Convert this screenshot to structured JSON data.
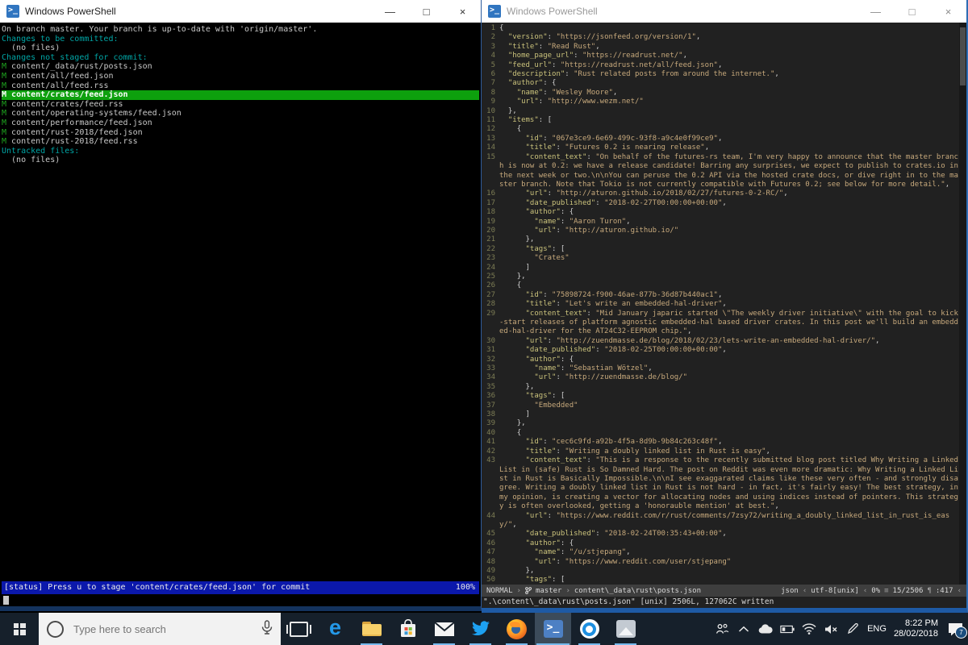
{
  "chrome": {
    "min": "—",
    "max": "□",
    "close": "×"
  },
  "left_window": {
    "title": "Windows PowerShell",
    "lines": [
      {
        "type": "plain",
        "text": "On branch master. Your branch is up-to-date with 'origin/master'."
      },
      {
        "type": "section",
        "text": "Changes to be committed:"
      },
      {
        "type": "plain",
        "text": "  (no files)"
      },
      {
        "type": "section",
        "text": "Changes not staged for commit:"
      },
      {
        "type": "file",
        "marker": "M",
        "text": "content/_data/rust/posts.json"
      },
      {
        "type": "file",
        "marker": "M",
        "text": "content/all/feed.json"
      },
      {
        "type": "file",
        "marker": "M",
        "text": "content/all/feed.rss"
      },
      {
        "type": "selected",
        "marker": "M",
        "text": "content/crates/feed.json"
      },
      {
        "type": "file",
        "marker": "M",
        "text": "content/crates/feed.rss"
      },
      {
        "type": "file",
        "marker": "M",
        "text": "content/operating-systems/feed.json"
      },
      {
        "type": "file",
        "marker": "M",
        "text": "content/performance/feed.json"
      },
      {
        "type": "file",
        "marker": "M",
        "text": "content/rust-2018/feed.json"
      },
      {
        "type": "file",
        "marker": "M",
        "text": "content/rust-2018/feed.rss"
      },
      {
        "type": "section",
        "text": "Untracked files:"
      },
      {
        "type": "plain",
        "text": "  (no files)"
      }
    ],
    "status_left": "[status] Press u to stage 'content/crates/feed.json' for commit",
    "status_right": "100%"
  },
  "right_window": {
    "title": "Windows PowerShell",
    "lines": [
      {
        "n": "1",
        "s": [
          [
            "p",
            "{"
          ]
        ]
      },
      {
        "n": "2",
        "s": [
          [
            "k",
            "  \"version\""
          ],
          [
            "p",
            ": "
          ],
          [
            "s",
            "\"https://jsonfeed.org/version/1\""
          ],
          [
            "p",
            ","
          ]
        ]
      },
      {
        "n": "3",
        "s": [
          [
            "k",
            "  \"title\""
          ],
          [
            "p",
            ": "
          ],
          [
            "s",
            "\"Read Rust\""
          ],
          [
            "p",
            ","
          ]
        ]
      },
      {
        "n": "4",
        "s": [
          [
            "k",
            "  \"home_page_url\""
          ],
          [
            "p",
            ": "
          ],
          [
            "s",
            "\"https://readrust.net/\""
          ],
          [
            "p",
            ","
          ]
        ]
      },
      {
        "n": "5",
        "s": [
          [
            "k",
            "  \"feed_url\""
          ],
          [
            "p",
            ": "
          ],
          [
            "s",
            "\"https://readrust.net/all/feed.json\""
          ],
          [
            "p",
            ","
          ]
        ]
      },
      {
        "n": "6",
        "s": [
          [
            "k",
            "  \"description\""
          ],
          [
            "p",
            ": "
          ],
          [
            "s",
            "\"Rust related posts from around the internet.\""
          ],
          [
            "p",
            ","
          ]
        ]
      },
      {
        "n": "7",
        "s": [
          [
            "k",
            "  \"author\""
          ],
          [
            "p",
            ": {"
          ]
        ]
      },
      {
        "n": "8",
        "s": [
          [
            "k",
            "    \"name\""
          ],
          [
            "p",
            ": "
          ],
          [
            "s",
            "\"Wesley Moore\""
          ],
          [
            "p",
            ","
          ]
        ]
      },
      {
        "n": "9",
        "s": [
          [
            "k",
            "    \"url\""
          ],
          [
            "p",
            ": "
          ],
          [
            "s",
            "\"http://www.wezm.net/\""
          ]
        ]
      },
      {
        "n": "10",
        "s": [
          [
            "p",
            "  },"
          ]
        ]
      },
      {
        "n": "11",
        "s": [
          [
            "k",
            "  \"items\""
          ],
          [
            "p",
            ": ["
          ]
        ]
      },
      {
        "n": "12",
        "s": [
          [
            "p",
            "    {"
          ]
        ]
      },
      {
        "n": "13",
        "s": [
          [
            "k",
            "      \"id\""
          ],
          [
            "p",
            ": "
          ],
          [
            "s",
            "\"067e3ce9-6e69-499c-93f8-a9c4e0f99ce9\""
          ],
          [
            "p",
            ","
          ]
        ]
      },
      {
        "n": "14",
        "s": [
          [
            "k",
            "      \"title\""
          ],
          [
            "p",
            ": "
          ],
          [
            "s",
            "\"Futures 0.2 is nearing release\""
          ],
          [
            "p",
            ","
          ]
        ]
      },
      {
        "n": "15",
        "s": [
          [
            "k",
            "      \"content_text\""
          ],
          [
            "p",
            ": "
          ],
          [
            "s",
            "\"On behalf of the futures-rs team, I'm very happy to announce that the master branch is now at 0.2: we have a release candidate! Barring any surprises, we expect to publish to crates.io in the next week or two.\\n\\nYou can peruse the 0.2 API via the hosted crate docs, or dive right in to the master branch. Note that Tokio is not currently compatible with Futures 0.2; see below for more detail.\""
          ],
          [
            "p",
            ","
          ]
        ]
      },
      {
        "n": "16",
        "s": [
          [
            "k",
            "      \"url\""
          ],
          [
            "p",
            ": "
          ],
          [
            "s",
            "\"http://aturon.github.io/2018/02/27/futures-0-2-RC/\""
          ],
          [
            "p",
            ","
          ]
        ]
      },
      {
        "n": "17",
        "s": [
          [
            "k",
            "      \"date_published\""
          ],
          [
            "p",
            ": "
          ],
          [
            "s",
            "\"2018-02-27T00:00:00+00:00\""
          ],
          [
            "p",
            ","
          ]
        ]
      },
      {
        "n": "18",
        "s": [
          [
            "k",
            "      \"author\""
          ],
          [
            "p",
            ": {"
          ]
        ]
      },
      {
        "n": "19",
        "s": [
          [
            "k",
            "        \"name\""
          ],
          [
            "p",
            ": "
          ],
          [
            "s",
            "\"Aaron Turon\""
          ],
          [
            "p",
            ","
          ]
        ]
      },
      {
        "n": "20",
        "s": [
          [
            "k",
            "        \"url\""
          ],
          [
            "p",
            ": "
          ],
          [
            "s",
            "\"http://aturon.github.io/\""
          ]
        ]
      },
      {
        "n": "21",
        "s": [
          [
            "p",
            "      },"
          ]
        ]
      },
      {
        "n": "22",
        "s": [
          [
            "k",
            "      \"tags\""
          ],
          [
            "p",
            ": ["
          ]
        ]
      },
      {
        "n": "23",
        "s": [
          [
            "s",
            "        \"Crates\""
          ]
        ]
      },
      {
        "n": "24",
        "s": [
          [
            "p",
            "      ]"
          ]
        ]
      },
      {
        "n": "25",
        "s": [
          [
            "p",
            "    },"
          ]
        ]
      },
      {
        "n": "26",
        "s": [
          [
            "p",
            "    {"
          ]
        ]
      },
      {
        "n": "27",
        "s": [
          [
            "k",
            "      \"id\""
          ],
          [
            "p",
            ": "
          ],
          [
            "s",
            "\"75898724-f900-46ae-877b-36d87b440ac1\""
          ],
          [
            "p",
            ","
          ]
        ]
      },
      {
        "n": "28",
        "s": [
          [
            "k",
            "      \"title\""
          ],
          [
            "p",
            ": "
          ],
          [
            "s",
            "\"Let's write an embedded-hal-driver\""
          ],
          [
            "p",
            ","
          ]
        ]
      },
      {
        "n": "29",
        "s": [
          [
            "k",
            "      \"content_text\""
          ],
          [
            "p",
            ": "
          ],
          [
            "s",
            "\"Mid January japaric started \\\"The weekly driver initiative\\\" with the goal to kick-start releases of platform agnostic embedded-hal based driver crates. In this post we'll build an embedded-hal-driver for the AT24C32-EEPROM chip.\""
          ],
          [
            "p",
            ","
          ]
        ]
      },
      {
        "n": "30",
        "s": [
          [
            "k",
            "      \"url\""
          ],
          [
            "p",
            ": "
          ],
          [
            "s",
            "\"http://zuendmasse.de/blog/2018/02/23/lets-write-an-embedded-hal-driver/\""
          ],
          [
            "p",
            ","
          ]
        ]
      },
      {
        "n": "31",
        "s": [
          [
            "k",
            "      \"date_published\""
          ],
          [
            "p",
            ": "
          ],
          [
            "s",
            "\"2018-02-25T00:00:00+00:00\""
          ],
          [
            "p",
            ","
          ]
        ]
      },
      {
        "n": "32",
        "s": [
          [
            "k",
            "      \"author\""
          ],
          [
            "p",
            ": {"
          ]
        ]
      },
      {
        "n": "33",
        "s": [
          [
            "k",
            "        \"name\""
          ],
          [
            "p",
            ": "
          ],
          [
            "s",
            "\"Sebastian Wötzel\""
          ],
          [
            "p",
            ","
          ]
        ]
      },
      {
        "n": "34",
        "s": [
          [
            "k",
            "        \"url\""
          ],
          [
            "p",
            ": "
          ],
          [
            "s",
            "\"http://zuendmasse.de/blog/\""
          ]
        ]
      },
      {
        "n": "35",
        "s": [
          [
            "p",
            "      },"
          ]
        ]
      },
      {
        "n": "36",
        "s": [
          [
            "k",
            "      \"tags\""
          ],
          [
            "p",
            ": ["
          ]
        ]
      },
      {
        "n": "37",
        "s": [
          [
            "s",
            "        \"Embedded\""
          ]
        ]
      },
      {
        "n": "38",
        "s": [
          [
            "p",
            "      ]"
          ]
        ]
      },
      {
        "n": "39",
        "s": [
          [
            "p",
            "    },"
          ]
        ]
      },
      {
        "n": "40",
        "s": [
          [
            "p",
            "    {"
          ]
        ]
      },
      {
        "n": "41",
        "s": [
          [
            "k",
            "      \"id\""
          ],
          [
            "p",
            ": "
          ],
          [
            "s",
            "\"cec6c9fd-a92b-4f5a-8d9b-9b84c263c48f\""
          ],
          [
            "p",
            ","
          ]
        ]
      },
      {
        "n": "42",
        "s": [
          [
            "k",
            "      \"title\""
          ],
          [
            "p",
            ": "
          ],
          [
            "s",
            "\"Writing a doubly linked list in Rust is easy\""
          ],
          [
            "p",
            ","
          ]
        ]
      },
      {
        "n": "43",
        "s": [
          [
            "k",
            "      \"content_text\""
          ],
          [
            "p",
            ": "
          ],
          [
            "s",
            "\"This is a response to the recently submitted blog post titled Why Writing a Linked List in (safe) Rust is So Damned Hard. The post on Reddit was even more dramatic: Why Writing a Linked List in Rust is Basically Impossible.\\n\\nI see exaggarated claims like these very often - and strongly disagree. Writing a doubly linked list in Rust is not hard - in fact, it's fairly easy! The best strategy, in my opinion, is creating a vector for allocating nodes and using indices instead of pointers. This strategy is often overlooked, getting a 'honorauble mention' at best.\""
          ],
          [
            "p",
            ","
          ]
        ]
      },
      {
        "n": "44",
        "s": [
          [
            "k",
            "      \"url\""
          ],
          [
            "p",
            ": "
          ],
          [
            "s",
            "\"https://www.reddit.com/r/rust/comments/7zsy72/writing_a_doubly_linked_list_in_rust_is_easy/\""
          ],
          [
            "p",
            ","
          ]
        ]
      },
      {
        "n": "45",
        "s": [
          [
            "k",
            "      \"date_published\""
          ],
          [
            "p",
            ": "
          ],
          [
            "s",
            "\"2018-02-24T00:35:43+00:00\""
          ],
          [
            "p",
            ","
          ]
        ]
      },
      {
        "n": "46",
        "s": [
          [
            "k",
            "      \"author\""
          ],
          [
            "p",
            ": {"
          ]
        ]
      },
      {
        "n": "47",
        "s": [
          [
            "k",
            "        \"name\""
          ],
          [
            "p",
            ": "
          ],
          [
            "s",
            "\"/u/stjepang\""
          ],
          [
            "p",
            ","
          ]
        ]
      },
      {
        "n": "48",
        "s": [
          [
            "k",
            "        \"url\""
          ],
          [
            "p",
            ": "
          ],
          [
            "s",
            "\"https://www.reddit.com/user/stjepang\""
          ]
        ]
      },
      {
        "n": "49",
        "s": [
          [
            "p",
            "      },"
          ]
        ]
      },
      {
        "n": "50",
        "s": [
          [
            "k",
            "      \"tags\""
          ],
          [
            "p",
            ": ["
          ]
        ]
      }
    ],
    "statusline": {
      "mode": "NORMAL",
      "sep_l": "›",
      "branch": "master",
      "file": "content\\_data\\rust\\posts.json",
      "filetype": "json",
      "sep_r": "‹",
      "encoding": "utf-8[unix]",
      "percent": "0%",
      "trigram": "≡",
      "position": "15/2506",
      "pilcrow": "¶",
      "column": ":417"
    },
    "message": "\".\\content\\_data\\rust\\posts.json\" [unix] 2506L, 127062C written"
  },
  "taskbar": {
    "search_placeholder": "Type here to search",
    "language": "ENG",
    "time": "8:22 PM",
    "date": "28/02/2018",
    "notification_count": "7",
    "colors": {
      "accent": "#2e6db4",
      "selection_green": "#0da00d",
      "status_blue": "#0b18ab"
    }
  }
}
